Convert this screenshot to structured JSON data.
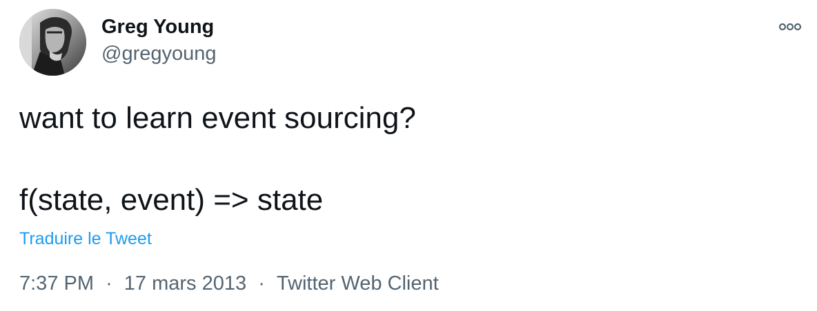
{
  "author": {
    "name": "Greg Young",
    "handle": "@gregyoung"
  },
  "tweet": {
    "line1": "want to learn event sourcing?",
    "line2": "f(state, event) => state",
    "translate_label": "Traduire le Tweet"
  },
  "meta": {
    "time": "7:37 PM",
    "separator": "·",
    "date": "17 mars 2013",
    "source": "Twitter Web Client"
  },
  "icons": {
    "more": "more-options-icon",
    "avatar": "avatar"
  },
  "colors": {
    "text": "#0f1419",
    "secondary": "#536471",
    "link": "#1d9bf0"
  }
}
